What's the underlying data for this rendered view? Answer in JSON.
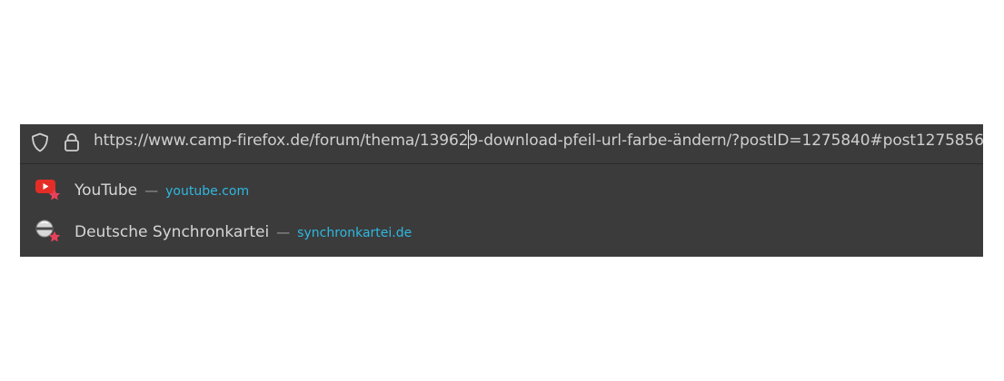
{
  "urlbar": {
    "url_before_caret": "https://www.camp-firefox.de/forum/thema/13962",
    "url_after_caret": "9-download-pfeil-url-farbe-ändern/?postID=1275840#post1275856",
    "shield_icon": "tracking-protection-shield-icon",
    "lock_icon": "secure-connection-lock-icon"
  },
  "results": [
    {
      "title": "YouTube",
      "separator": "—",
      "url": "youtube.com",
      "favicon": "youtube-icon",
      "badge": "bookmark-star-icon"
    },
    {
      "title": "Deutsche Synchronkartei",
      "separator": "—",
      "url": "synchronkartei.de",
      "favicon": "synchronkartei-icon",
      "badge": "bookmark-star-icon"
    }
  ],
  "colors": {
    "panel_bg": "#3b3b3b",
    "text": "#d6d6d6",
    "url_accent": "#2fb8e0",
    "star": "#e8425b",
    "youtube_red": "#e52d27"
  }
}
